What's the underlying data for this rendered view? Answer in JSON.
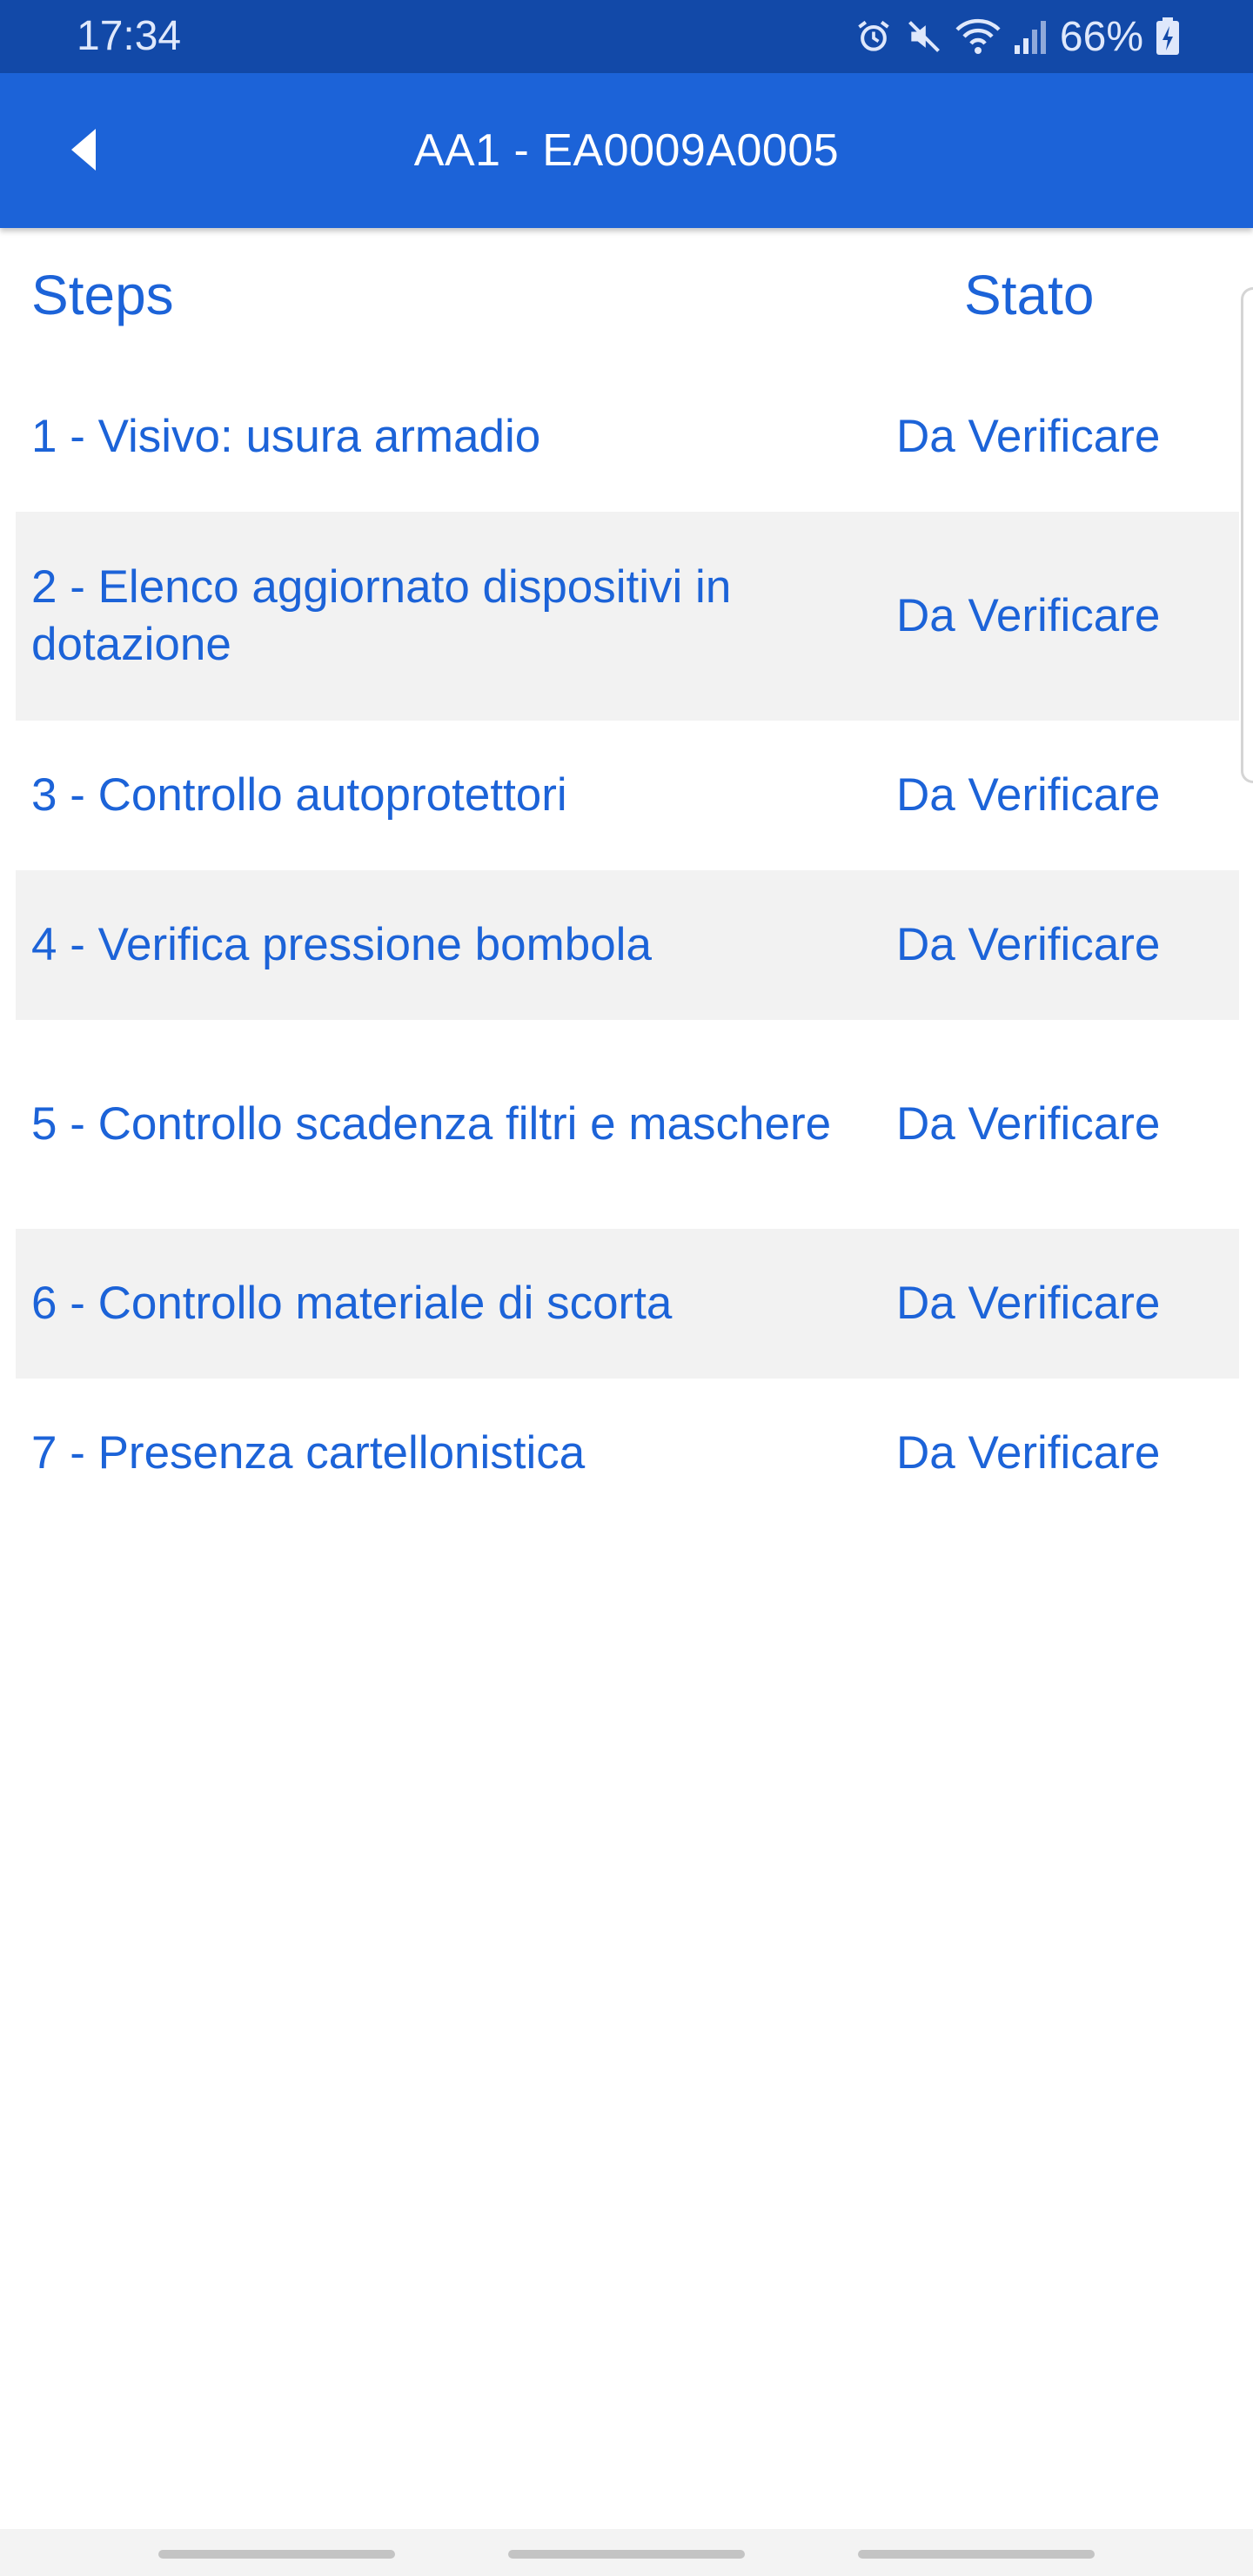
{
  "status_bar": {
    "time": "17:34",
    "battery": "66%",
    "icons": [
      "alarm-icon",
      "mute-icon",
      "wifi-icon",
      "signal-icon",
      "battery-charging-icon"
    ]
  },
  "app_bar": {
    "title": "AA1 - EA0009A0005",
    "back_icon": "back-arrow-icon"
  },
  "table": {
    "header_steps": "Steps",
    "header_state": "Stato",
    "rows": [
      {
        "step": "1 - Visivo: usura armadio",
        "state": "Da Verificare"
      },
      {
        "step": "2 - Elenco aggiornato dispositivi in dotazione",
        "state": "Da Verificare"
      },
      {
        "step": "3 - Controllo autoprotettori",
        "state": "Da Verificare"
      },
      {
        "step": "4 - Verifica pressione bombola",
        "state": "Da Verificare"
      },
      {
        "step": "5 - Controllo scadenza filtri e maschere",
        "state": "Da Verificare"
      },
      {
        "step": "6 - Controllo materiale di scorta",
        "state": "Da Verificare"
      },
      {
        "step": "7 - Presenza cartellonistica",
        "state": "Da Verificare"
      }
    ]
  },
  "colors": {
    "status_bar": "#1249a8",
    "app_bar": "#1c63d8",
    "text_accent": "#1c63d8",
    "row_alt": "#f2f2f2"
  }
}
